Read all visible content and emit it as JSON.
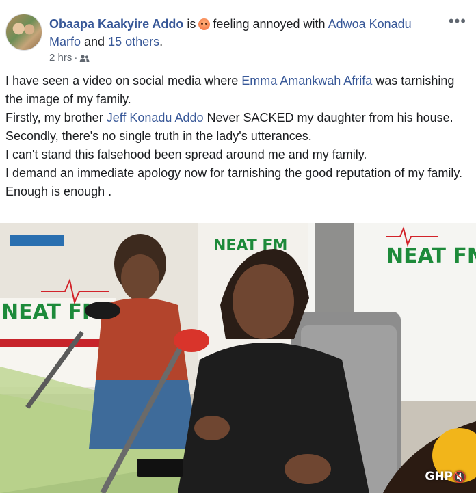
{
  "post": {
    "author": "Obaapa Kaakyire Addo",
    "is_text": "is",
    "feeling_text": "feeling annoyed with",
    "tagged_1": "Adwoa Konadu Marfo",
    "and_text": "and",
    "tagged_others": "15 others",
    "period": ".",
    "timestamp": "2 hrs",
    "dot": "·",
    "audience_icon": "friends-icon",
    "more_icon": "•••",
    "emoji_icon": "annoyed-face-icon"
  },
  "body": {
    "l1_a": "I have seen a video on social media where ",
    "l1_link": "Emma Amankwah Afrifa",
    "l1_b": " was tarnishing the image of my family.",
    "l2_a": "Firstly, my brother ",
    "l2_link": "Jeff Konadu Addo",
    "l2_b": " Never SACKED my daughter from his house.",
    "l3": "Secondly, there's no single truth in the lady's utterances.",
    "l4": "I can't stand this falsehood been spread around me and my family.",
    "l5": "I demand an immediate apology now for tarnishing the good reputation of my family. Enough is enough ."
  },
  "media": {
    "sign_left": "NEAT FM",
    "sign_center": "NEAT FM",
    "sign_right": "NEAT FM",
    "watermark": "GHP",
    "mute_icon": "mute-icon"
  },
  "colors": {
    "link": "#385898",
    "station_green": "#1d8a3a",
    "station_red": "#d2232a"
  }
}
